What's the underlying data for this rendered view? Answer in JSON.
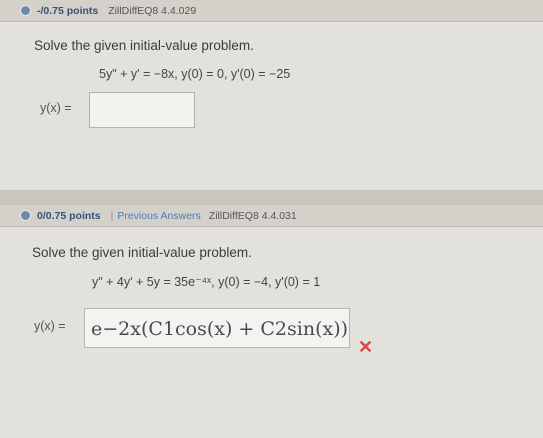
{
  "q1": {
    "points": "-/0.75 points",
    "code": "ZillDiffEQ8 4.4.029",
    "prompt": "Solve the given initial-value problem.",
    "equation": "5y\" + y' = −8x,  y(0) = 0, y'(0) = −25",
    "answer_label": "y(x) =",
    "answer_value": ""
  },
  "q2": {
    "points": "0/0.75 points",
    "separator": "|",
    "previous_answers": "Previous Answers",
    "code": "ZillDiffEQ8 4.4.031",
    "prompt": "Solve the given initial-value problem.",
    "equation": "y\" + 4y' + 5y = 35e⁻⁴ˣ,  y(0) = −4, y'(0) = 1",
    "answer_label": "y(x) =",
    "answer_value": "e−2x(C1cos(x) + C2sin(x))",
    "answer_status": "incorrect",
    "answer_status_icon": "cross-icon"
  },
  "colors": {
    "incorrect": "#d24a4a",
    "link": "#4f7bb3",
    "points": "#35527a"
  }
}
